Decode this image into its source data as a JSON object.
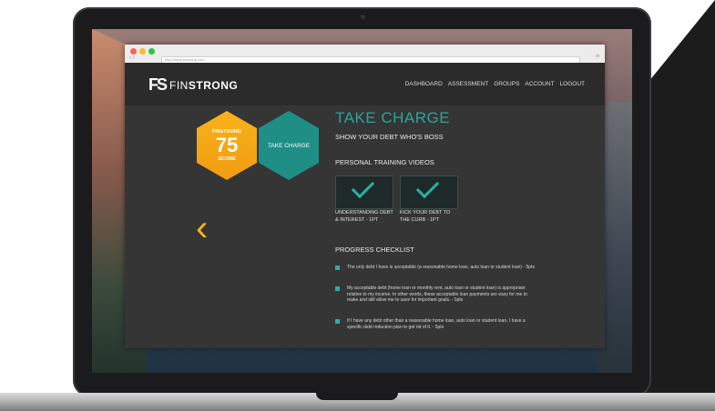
{
  "browser": {
    "url": "http://www.finstrong.com"
  },
  "app": {
    "logo_mark": "FS",
    "logo_text_light": "FIN",
    "logo_text_bold": "STRONG",
    "nav": [
      "DASHBOARD",
      "ASSESSMENT",
      "GROUPS",
      "ACCOUNT",
      "LOGOUT"
    ]
  },
  "score_hex": {
    "label_top": "FINSTRONG",
    "value": "75",
    "label_bottom": "SCORE"
  },
  "take_hex": {
    "label": "TAKE CHARGE"
  },
  "main": {
    "title": "TAKE CHARGE",
    "subtitle": "SHOW YOUR DEBT WHO'S BOSS",
    "videos_title": "PERSONAL TRAINING VIDEOS",
    "videos": [
      {
        "caption": "UNDERSTANDING DEBT & INTEREST - 1PT"
      },
      {
        "caption": "KICK YOUR DEBT TO THE CURB - 1PT"
      }
    ],
    "progress_title": "PROGRESS CHECKLIST",
    "checklist": [
      "The only debt I have is acceptable (a reasonable home loan, auto loan or student loan) - 5pts",
      "My acceptable debt (home loan or monthly rent, auto loan or student loan) is appropriate relative to my income. In other words, these acceptable loan payments are easy for me to make and still allow me to save for important goals. - 5pts",
      "If I have any debt other than a reasonable home loan, auto loan or student loan, I have a specific debt reduction plan to get rid of it. - 5pts"
    ]
  },
  "colors": {
    "accent_teal": "#2aa59a",
    "accent_orange": "#f8b21a"
  }
}
